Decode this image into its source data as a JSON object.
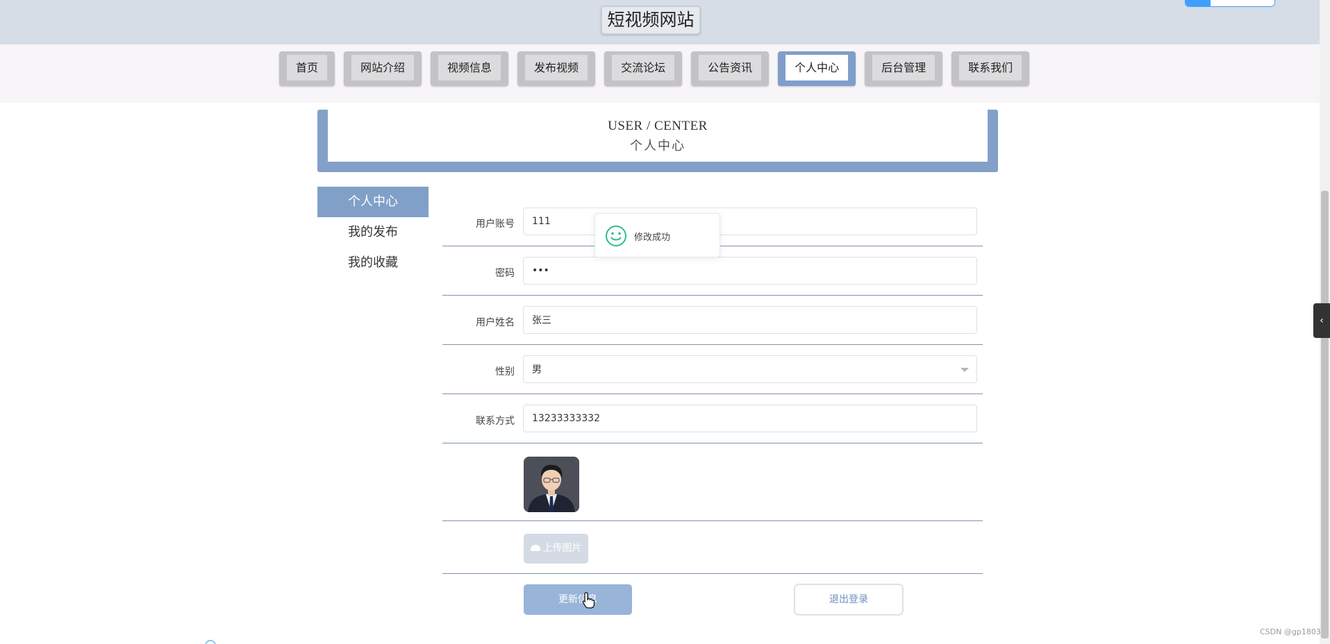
{
  "site": {
    "title": "短视频网站"
  },
  "nav": {
    "items": [
      {
        "label": "首页",
        "active": false
      },
      {
        "label": "网站介绍",
        "active": false
      },
      {
        "label": "视频信息",
        "active": false
      },
      {
        "label": "发布视频",
        "active": false
      },
      {
        "label": "交流论坛",
        "active": false
      },
      {
        "label": "公告资讯",
        "active": false
      },
      {
        "label": "个人中心",
        "active": true
      },
      {
        "label": "后台管理",
        "active": false
      },
      {
        "label": "联系我们",
        "active": false
      }
    ]
  },
  "banner": {
    "english": "USER / CENTER",
    "chinese": "个人中心"
  },
  "sidebar": {
    "items": [
      {
        "label": "个人中心",
        "active": true
      },
      {
        "label": "我的发布",
        "active": false
      },
      {
        "label": "我的收藏",
        "active": false
      }
    ]
  },
  "form": {
    "account": {
      "label": "用户账号",
      "value": "111"
    },
    "password": {
      "label": "密码",
      "value": "•••"
    },
    "name": {
      "label": "用户姓名",
      "value": "张三"
    },
    "gender": {
      "label": "性别",
      "value": "男"
    },
    "phone": {
      "label": "联系方式",
      "value": "13233333332"
    },
    "upload_label": "上传图片",
    "update_label": "更新信息",
    "logout_label": "退出登录"
  },
  "toast": {
    "message": "修改成功"
  },
  "watermark": "CSDN @gp1803",
  "colors": {
    "accent": "#83a1c8",
    "header_bg": "#d6dde7",
    "toast_icon": "#2ebd8a",
    "link_blue": "#409eff"
  }
}
